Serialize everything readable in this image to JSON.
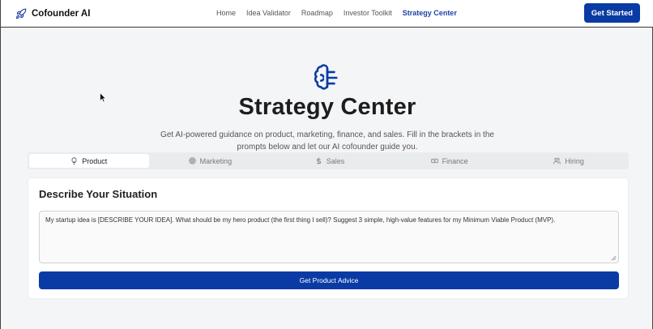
{
  "brand": {
    "name": "Cofounder AI"
  },
  "nav": {
    "items": [
      {
        "label": "Home"
      },
      {
        "label": "Idea Validator"
      },
      {
        "label": "Roadmap"
      },
      {
        "label": "Investor Toolkit"
      },
      {
        "label": "Strategy Center"
      }
    ],
    "active": "Strategy Center",
    "cta_label": "Get Started"
  },
  "hero": {
    "icon": "brain-icon",
    "title": "Strategy Center",
    "subtitle": "Get AI-powered guidance on product, marketing, finance, and sales. Fill in the brackets in the prompts below and let our AI cofounder guide you."
  },
  "tabs": [
    {
      "label": "Product",
      "icon": "lightbulb-icon"
    },
    {
      "label": "Marketing",
      "icon": "target-icon"
    },
    {
      "label": "Sales",
      "icon": "dollar-icon"
    },
    {
      "label": "Finance",
      "icon": "banknote-icon"
    },
    {
      "label": "Hiring",
      "icon": "users-icon"
    }
  ],
  "active_tab": "Product",
  "card": {
    "title": "Describe Your Situation",
    "prompt_value": "My startup idea is [DESCRIBE YOUR IDEA]. What should be my hero product (the first thing I sell)? Suggest 3 simple, high-value features for my Minimum Viable Product (MVP).",
    "button_label": "Get Product Advice"
  },
  "colors": {
    "accent": "#0a3ba5",
    "active_nav": "#1e3fa8",
    "background": "#f4f5f7"
  }
}
